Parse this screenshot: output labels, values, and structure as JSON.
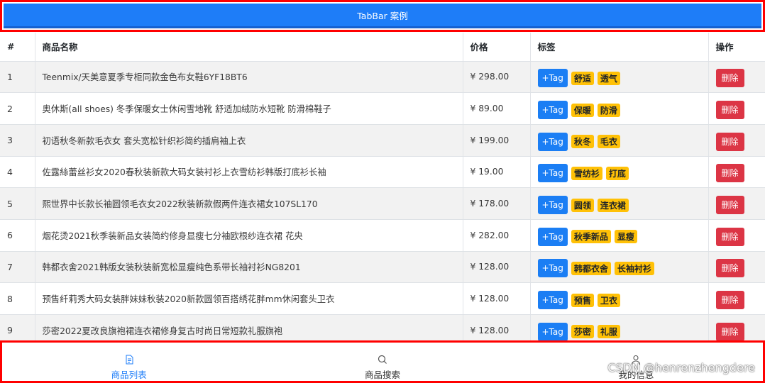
{
  "header": {
    "title": "TabBar 案例"
  },
  "table": {
    "columns": [
      "#",
      "商品名称",
      "价格",
      "标签",
      "操作"
    ],
    "add_tag_label": "+Tag",
    "delete_label": "删除",
    "rows": [
      {
        "id": "1",
        "name": "Teenmix/天美意夏季专柜同款金色布女鞋6YF18BT6",
        "price": "¥ 298.00",
        "tags": [
          "舒适",
          "透气"
        ]
      },
      {
        "id": "2",
        "name": "奥休斯(all shoes) 冬季保暖女士休闲雪地靴 舒适加绒防水短靴 防滑棉鞋子",
        "price": "¥ 89.00",
        "tags": [
          "保暖",
          "防滑"
        ]
      },
      {
        "id": "3",
        "name": "初语秋冬新款毛衣女 套头宽松针织衫简约插肩袖上衣",
        "price": "¥ 199.00",
        "tags": [
          "秋冬",
          "毛衣"
        ]
      },
      {
        "id": "4",
        "name": "佐露絲蕾丝衫女2020春秋装新款大码女装衬衫上衣雪纺衫韩版打底衫长袖",
        "price": "¥ 19.00",
        "tags": [
          "雪纺衫",
          "打底"
        ]
      },
      {
        "id": "5",
        "name": "熙世界中长款长袖圆领毛衣女2022秋装新款假两件连衣裙女107SL170",
        "price": "¥ 178.00",
        "tags": [
          "圆领",
          "连衣裙"
        ]
      },
      {
        "id": "6",
        "name": "烟花烫2021秋季装新品女装简约修身显瘦七分袖欧根纱连衣裙 花央",
        "price": "¥ 282.00",
        "tags": [
          "秋季新品",
          "显瘦"
        ]
      },
      {
        "id": "7",
        "name": "韩都衣舍2021韩版女装秋装新宽松显瘦纯色系带长袖衬衫NG8201",
        "price": "¥ 128.00",
        "tags": [
          "韩都衣舍",
          "长袖衬衫"
        ]
      },
      {
        "id": "8",
        "name": "预售纤莉秀大码女装胖妹妹秋装2020新款圆领百搭绣花胖mm休闲套头卫衣",
        "price": "¥ 128.00",
        "tags": [
          "预售",
          "卫衣"
        ]
      },
      {
        "id": "9",
        "name": "莎密2022夏改良旗袍裙连衣裙修身复古时尚日常短款礼服旗袍",
        "price": "¥ 128.00",
        "tags": [
          "莎密",
          "礼服"
        ]
      }
    ]
  },
  "tabbar": {
    "tabs": [
      {
        "label": "商品列表",
        "icon": "list-doc-icon",
        "active": true
      },
      {
        "label": "商品搜索",
        "icon": "search-icon",
        "active": false
      },
      {
        "label": "我的信息",
        "icon": "user-icon",
        "active": false
      }
    ]
  },
  "watermark": "CSDN @henrenzhengdere",
  "colors": {
    "primary": "#1e7df8",
    "danger": "#dc3545",
    "warning": "#ffc107",
    "frame": "#ff0000"
  }
}
